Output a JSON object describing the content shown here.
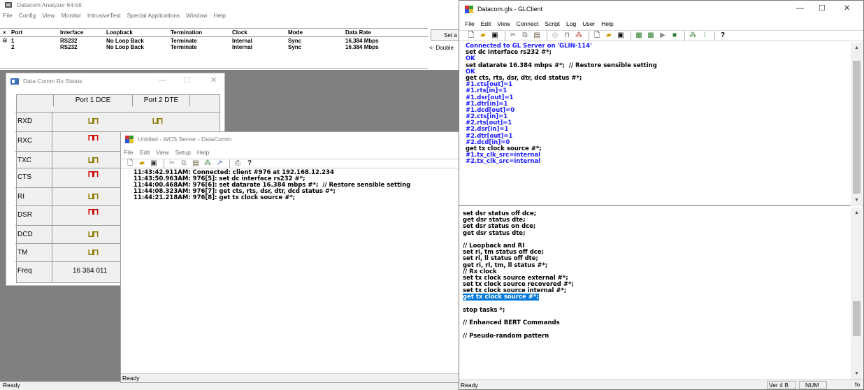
{
  "analyzer": {
    "title": "Datacom Analyzer 64-bit",
    "menu": [
      "File",
      "Config",
      "View",
      "Monitor",
      "IntrusiveTest",
      "Special Applications",
      "Window",
      "Help"
    ],
    "columns": [
      "Port",
      "Interface",
      "Loopback",
      "Termination",
      "Clock",
      "Mode",
      "Data Rate"
    ],
    "rows": [
      [
        "1",
        "RS232",
        "No Loop Back",
        "Terminate",
        "Internal",
        "Sync",
        "16.384 Mbps"
      ],
      [
        "2",
        "RS232",
        "No Loop Back",
        "Terminate",
        "Internal",
        "Sync",
        "16.384 Mbps"
      ]
    ],
    "side_button": "Set a",
    "side_button2": "<- Double",
    "status": "Ready"
  },
  "rx_status": {
    "title": "Data Comm Rx Status",
    "headers": [
      "Port 1 DCE",
      "Port 2 DTE"
    ],
    "rows": [
      "RXD",
      "RXC",
      "TXC",
      "CTS",
      "RI",
      "DSR",
      "DCD",
      "TM",
      "Freq"
    ],
    "freq_value": "16 384 011"
  },
  "wcs": {
    "title": "Untitled - WCS Server - DataComm",
    "menu": [
      "File",
      "Edit",
      "View",
      "Setup",
      "Help"
    ],
    "log": [
      "11:43:42.911AM: Connected: client #976 at 192.168.12.234",
      "11:43:50.963AM: 976[5]: set dc interface rs232 #*;",
      "11:44:00.468AM: 976[6]: set datarate 16.384 mbps #*;  // Restore sensible setting",
      "11:44:08.323AM: 976[7]: get cts, rts, dsr, dtr, dcd status #*;",
      "11:44:21.218AM: 976[8]: get tx clock source #*;"
    ],
    "status": "Ready"
  },
  "glclient": {
    "title": "Datacom.gls - GLClient",
    "menu": [
      "File",
      "Edit",
      "View",
      "Connect",
      "Script",
      "Log",
      "User",
      "Help"
    ],
    "output": [
      {
        "t": "Connected to GL Server on 'GLIN-114'",
        "c": "blue"
      },
      {
        "t": "set dc interface rs232 #*;",
        "c": "black"
      },
      {
        "t": "OK",
        "c": "blue"
      },
      {
        "t": "set datarate 16.384 mbps #*;  // Restore sensible setting",
        "c": "black"
      },
      {
        "t": "OK",
        "c": "blue"
      },
      {
        "t": "get cts, rts, dsr, dtr, dcd status #*;",
        "c": "black"
      },
      {
        "t": "#1.cts[out]=1",
        "c": "blue"
      },
      {
        "t": "#1.rts[in]=1",
        "c": "blue"
      },
      {
        "t": "#1.dsr[out]=1",
        "c": "blue"
      },
      {
        "t": "#1.dtr[in]=1",
        "c": "blue"
      },
      {
        "t": "#1.dcd[out]=0",
        "c": "blue"
      },
      {
        "t": "#2.cts[in]=1",
        "c": "blue"
      },
      {
        "t": "#2.rts[out]=1",
        "c": "blue"
      },
      {
        "t": "#2.dsr[in]=1",
        "c": "blue"
      },
      {
        "t": "#2.dtr[out]=1",
        "c": "blue"
      },
      {
        "t": "#2.dcd[in]=0",
        "c": "blue"
      },
      {
        "t": "get tx clock source #*;",
        "c": "black"
      },
      {
        "t": "#1.tx_clk_src=internal",
        "c": "blue"
      },
      {
        "t": "#2.tx_clk_src=internal",
        "c": "blue"
      }
    ],
    "script": [
      {
        "t": "set dsr status off dce;"
      },
      {
        "t": "get dsr status dte;"
      },
      {
        "t": "set dsr status on dce;"
      },
      {
        "t": "get dsr status dte;"
      },
      {
        "t": ""
      },
      {
        "t": "// Loopback and RI"
      },
      {
        "t": "set ri, tm status off dce;"
      },
      {
        "t": "set rl, ll status off dte;"
      },
      {
        "t": "get ri, rl, tm, ll status #*;"
      },
      {
        "t": "// Rx clock"
      },
      {
        "t": "set tx clock source external #*;"
      },
      {
        "t": "set tx clock source recovered #*;"
      },
      {
        "t": "set tx clock source internal #*;"
      },
      {
        "t": "get tx clock source #*;",
        "hl": true
      },
      {
        "t": ""
      },
      {
        "t": "stop tasks *;"
      },
      {
        "t": ""
      },
      {
        "t": "// Enhanced BERT Commands"
      },
      {
        "t": ""
      },
      {
        "t": "// Pseudo-random pattern"
      }
    ],
    "status": "Ready",
    "status_ver": "Ver 4 B",
    "status_num": "NUM",
    "status_fragment": "fo"
  },
  "colors": {
    "blue_text": "#1a1aff",
    "highlight": "#0078d7",
    "signal_olive": "#8a7a00",
    "signal_red": "#c80000"
  }
}
